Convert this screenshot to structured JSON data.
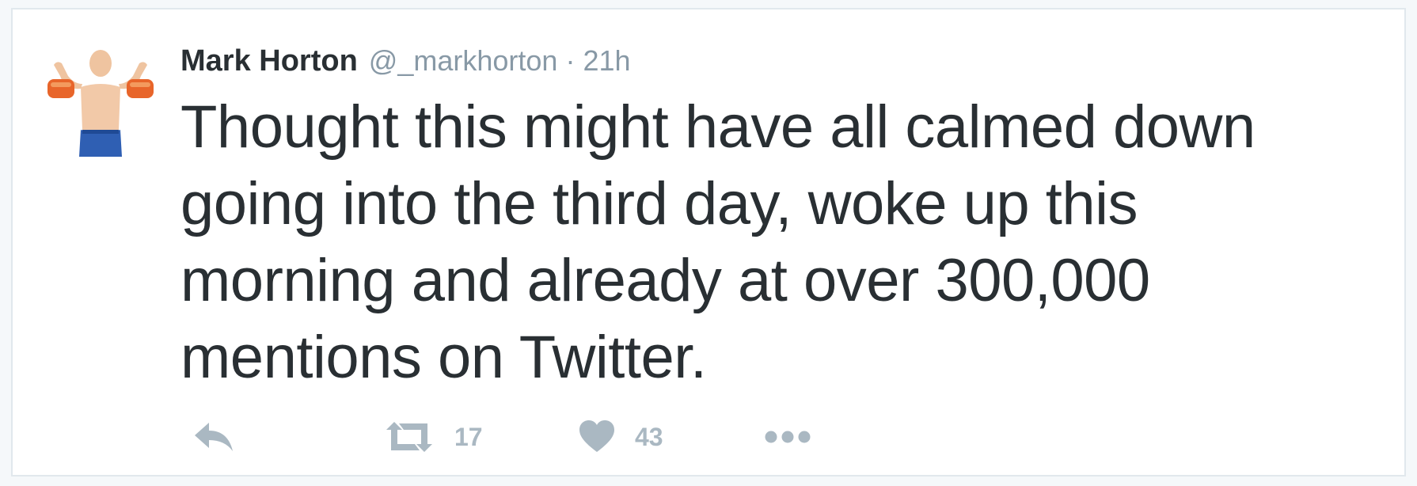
{
  "tweet": {
    "author_name": "Mark Horton",
    "handle": "@_markhorton",
    "separator": "·",
    "time": "21h",
    "text_lines": [
      "Thought this might have all calmed down",
      "going into the third day, woke up this",
      "morning and already at over 300,000",
      "mentions on Twitter."
    ],
    "retweet_count": "17",
    "like_count": "43"
  },
  "icons": {
    "reply": "reply-icon",
    "retweet": "retweet-icon",
    "like": "heart-icon",
    "more": "more-icon"
  },
  "colors": {
    "text": "#292f33",
    "muted": "#8899a6",
    "action": "#aab8c2",
    "border": "#e1e8ed"
  }
}
